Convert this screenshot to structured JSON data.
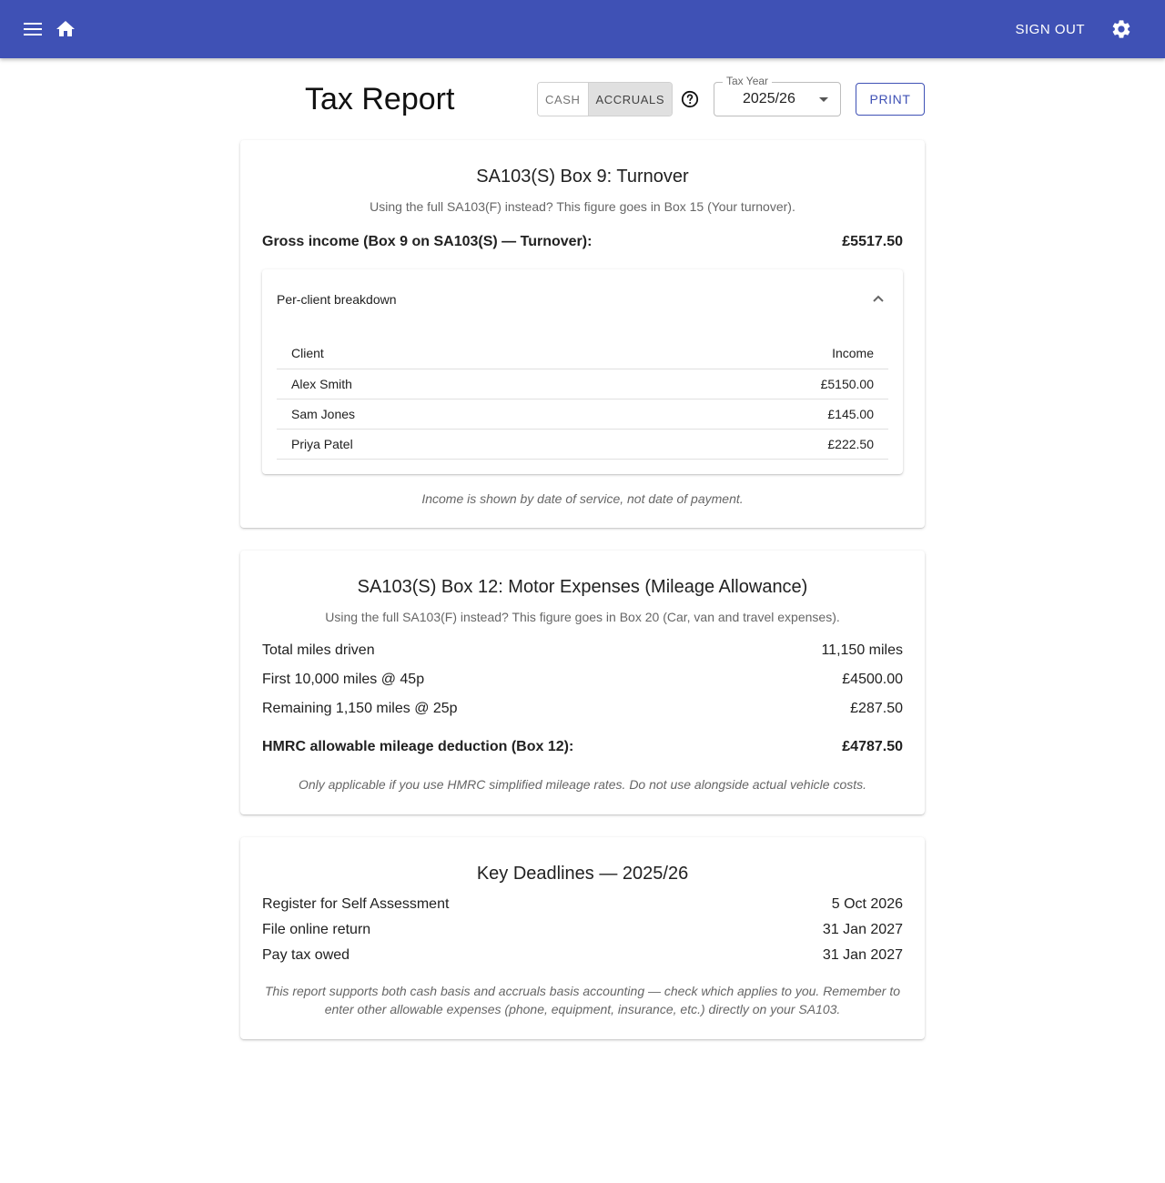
{
  "appbar": {
    "menu_icon": "menu-icon",
    "home_icon": "home-icon",
    "sign_out_label": "SIGN OUT",
    "settings_icon": "gear-icon",
    "color": "#3f51b5"
  },
  "header": {
    "title": "Tax Report",
    "basis_options": [
      "CASH",
      "ACCRUALS"
    ],
    "basis_selected": "ACCRUALS",
    "help_icon": "help-circle-icon",
    "tax_year_label": "Tax Year",
    "tax_year_value": "2025/26",
    "print_label": "PRINT"
  },
  "turnover": {
    "title": "SA103(S) Box 9: Turnover",
    "subtitle": "Using the full SA103(F) instead? This figure goes in Box 15 (Your turnover).",
    "gross_label": "Gross income (Box 9 on SA103(S) — Turnover):",
    "gross_value": "£5517.50",
    "breakdown_label": "Per-client breakdown",
    "breakdown_expanded": true,
    "columns": [
      "Client",
      "Income"
    ],
    "rows": [
      {
        "client": "Alex Smith",
        "income": "£5150.00"
      },
      {
        "client": "Sam Jones",
        "income": "£145.00"
      },
      {
        "client": "Priya Patel",
        "income": "£222.50"
      }
    ],
    "note": "Income is shown by date of service, not date of payment."
  },
  "mileage": {
    "title": "SA103(S) Box 12: Motor Expenses (Mileage Allowance)",
    "subtitle": "Using the full SA103(F) instead? This figure goes in Box 20 (Car, van and travel expenses).",
    "rows": [
      {
        "label": "Total miles driven",
        "value": "11,150 miles"
      },
      {
        "label": "First 10,000 miles @ 45p",
        "value": "£4500.00"
      },
      {
        "label": "Remaining 1,150 miles @ 25p",
        "value": "£287.50"
      }
    ],
    "total_label": "HMRC allowable mileage deduction (Box 12):",
    "total_value": "£4787.50",
    "note": "Only applicable if you use HMRC simplified mileage rates. Do not use alongside actual vehicle costs."
  },
  "deadlines": {
    "title": "Key Deadlines — 2025/26",
    "rows": [
      {
        "label": "Register for Self Assessment",
        "value": "5 Oct 2026"
      },
      {
        "label": "File online return",
        "value": "31 Jan 2027"
      },
      {
        "label": "Pay tax owed",
        "value": "31 Jan 2027"
      }
    ],
    "note": "This report supports both cash basis and accruals basis accounting — check which applies to you. Remember to enter other allowable expenses (phone, equipment, insurance, etc.) directly on your SA103."
  }
}
